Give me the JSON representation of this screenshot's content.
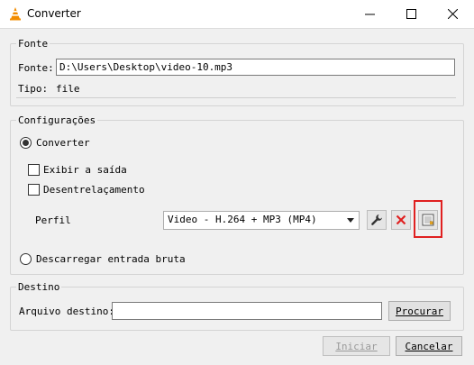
{
  "window": {
    "title": "Converter"
  },
  "source": {
    "group_title": "Fonte",
    "fonte_label": "Fonte:",
    "fonte_value": "D:\\Users\\Desktop\\video-10.mp3",
    "tipo_label": "Tipo:",
    "tipo_value": "file"
  },
  "settings": {
    "group_title": "Configurações",
    "convert_label": "Converter",
    "convert_selected": true,
    "show_output_label": "Exibir a saída",
    "deinterlace_label": "Desentrelaçamento",
    "profile_label": "Perfil",
    "profile_value": "Video - H.264 + MP3 (MP4)",
    "raw_dump_label": "Descarregar entrada bruta"
  },
  "destination": {
    "group_title": "Destino",
    "file_label": "Arquivo destino:",
    "file_value": "",
    "browse_label": "Procurar"
  },
  "footer": {
    "start_label": "Iniciar",
    "cancel_label": "Cancelar"
  },
  "colors": {
    "highlight": "#e02020",
    "accent": "#0078d7",
    "delete_red": "#e02020"
  }
}
